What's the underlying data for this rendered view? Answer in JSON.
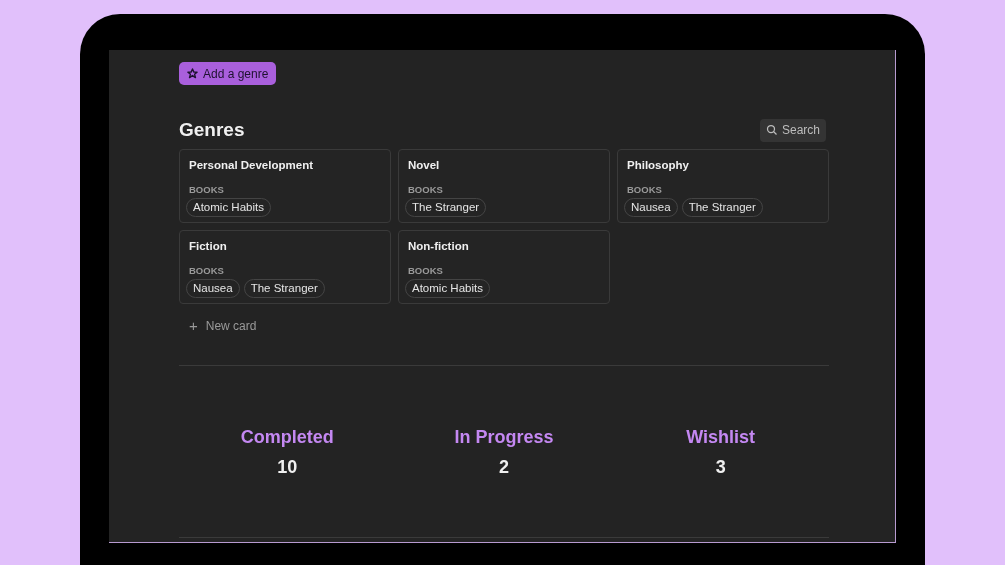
{
  "add_button": {
    "label": "Add a genre"
  },
  "section": {
    "title": "Genres",
    "search_label": "Search"
  },
  "cards": [
    {
      "title": "Personal Development",
      "property": "BOOKS",
      "tags": [
        "Atomic Habits"
      ]
    },
    {
      "title": "Novel",
      "property": "BOOKS",
      "tags": [
        "The Stranger"
      ]
    },
    {
      "title": "Philosophy",
      "property": "BOOKS",
      "tags": [
        "Nausea",
        "The Stranger"
      ]
    },
    {
      "title": "Fiction",
      "property": "BOOKS",
      "tags": [
        "Nausea",
        "The Stranger"
      ]
    },
    {
      "title": "Non-fiction",
      "property": "BOOKS",
      "tags": [
        "Atomic Habits"
      ]
    }
  ],
  "new_card": {
    "plus": "+",
    "label": "New card"
  },
  "stats": [
    {
      "label": "Completed",
      "value": "10"
    },
    {
      "label": "In Progress",
      "value": "2"
    },
    {
      "label": "Wishlist",
      "value": "3"
    }
  ]
}
